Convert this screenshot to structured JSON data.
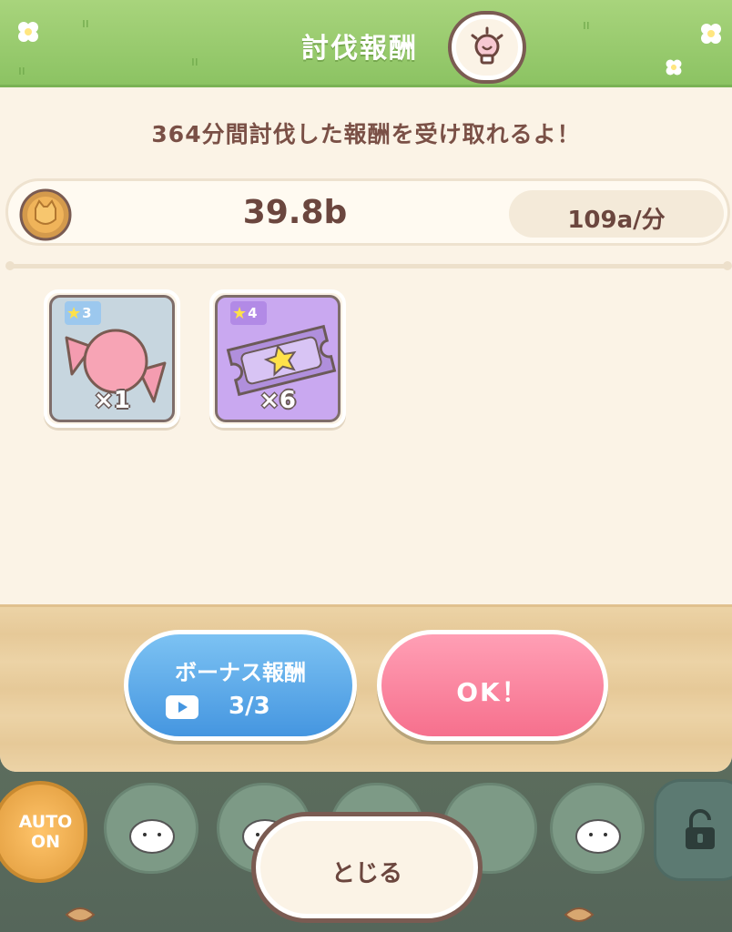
{
  "header": {
    "title": "討伐報酬",
    "hint_icon": "lightbulb-icon"
  },
  "message": "364分間討伐した報酬を受け取れるよ！",
  "coins": {
    "amount": "39.8b",
    "rate": "109a/分",
    "icon": "cat-coin-icon"
  },
  "items": [
    {
      "name": "candy",
      "stars": "3",
      "quantity": "×1",
      "color": "#c7d6df",
      "tag_color": "#9cc8ee",
      "icon": "candy-icon"
    },
    {
      "name": "ticket",
      "stars": "4",
      "quantity": "×6",
      "color": "#c9a8f0",
      "tag_color": "#b28ae6",
      "icon": "star-ticket-icon"
    }
  ],
  "buttons": {
    "bonus_label": "ボーナス報酬",
    "bonus_count": "3/3",
    "ok_label": "OK！",
    "close_label": "とじる"
  },
  "bottom_bar": {
    "auto_label": "AUTO ON"
  },
  "colors": {
    "header_green": "#8cc363",
    "ok_pink": "#f6708d",
    "bonus_blue": "#4596e0",
    "text_brown": "#6b463e"
  }
}
